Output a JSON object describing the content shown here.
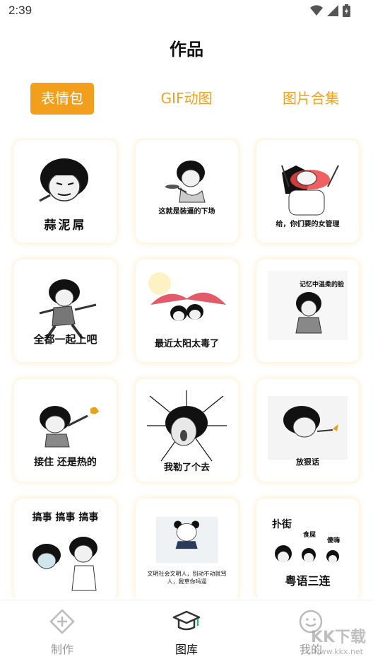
{
  "status": {
    "time": "2:39"
  },
  "header": {
    "title": "作品"
  },
  "tabs": [
    {
      "label": "表情包",
      "active": true
    },
    {
      "label": "GIF动图",
      "active": false
    },
    {
      "label": "图片合集",
      "active": false
    }
  ],
  "memes": [
    {
      "caption": "蒜泥屌"
    },
    {
      "caption": "这就是装逼的下场"
    },
    {
      "caption": "给，你们要的女管理"
    },
    {
      "caption": "全都一起上吧"
    },
    {
      "caption": "最近太阳太毒了"
    },
    {
      "caption": "记忆中温柔的脸"
    },
    {
      "caption": "接住 还是热的"
    },
    {
      "caption": "我勒了个去"
    },
    {
      "caption": "放狠话"
    },
    {
      "caption": "搞事 搞事 搞事"
    },
    {
      "caption": "文明社会文明人，别动不动就骂人，我草你吗逼"
    },
    {
      "caption": "粤语三连",
      "extra": [
        "扑街",
        "食屎",
        "傻嗨"
      ]
    }
  ],
  "nav": [
    {
      "label": "制作",
      "icon": "diamond-plus-icon"
    },
    {
      "label": "图库",
      "icon": "graduation-cap-icon",
      "active": true
    },
    {
      "label": "我的",
      "icon": "smiley-icon"
    }
  ],
  "watermark": {
    "text": "KK下载",
    "url": "www.kkx.net"
  },
  "colors": {
    "accent": "#F39F1E",
    "tab_text": "#F3A122"
  }
}
